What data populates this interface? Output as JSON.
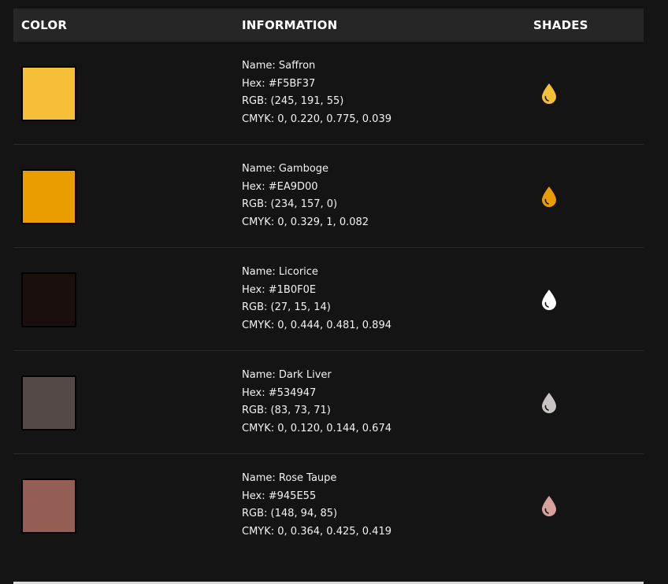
{
  "header": {
    "color": "COLOR",
    "information": "INFORMATION",
    "shades": "SHADES"
  },
  "colors": [
    {
      "name": "Name: Saffron",
      "hex": "Hex: #F5BF37",
      "rgb": "RGB: (245, 191, 55)",
      "cmyk": "CMYK: 0, 0.220, 0.775, 0.039",
      "swatch": "#F5BF37",
      "drop": "#F5BF37"
    },
    {
      "name": "Name: Gamboge",
      "hex": "Hex: #EA9D00",
      "rgb": "RGB: (234, 157, 0)",
      "cmyk": "CMYK: 0, 0.329, 1, 0.082",
      "swatch": "#EA9D00",
      "drop": "#EA9D00"
    },
    {
      "name": "Name: Licorice",
      "hex": "Hex: #1B0F0E",
      "rgb": "RGB: (27, 15, 14)",
      "cmyk": "CMYK: 0, 0.444, 0.481, 0.894",
      "swatch": "#1B0F0E",
      "drop": "#FFFFFF"
    },
    {
      "name": "Name: Dark Liver",
      "hex": "Hex: #534947",
      "rgb": "RGB: (83, 73, 71)",
      "cmyk": "CMYK: 0, 0.120, 0.144, 0.674",
      "swatch": "#534947",
      "drop": "#C8C4C3"
    },
    {
      "name": "Name: Rose Taupe",
      "hex": "Hex: #945E55",
      "rgb": "RGB: (148, 94, 85)",
      "cmyk": "CMYK: 0, 0.364, 0.425, 0.419",
      "swatch": "#945E55",
      "drop": "#D6A29A"
    }
  ]
}
